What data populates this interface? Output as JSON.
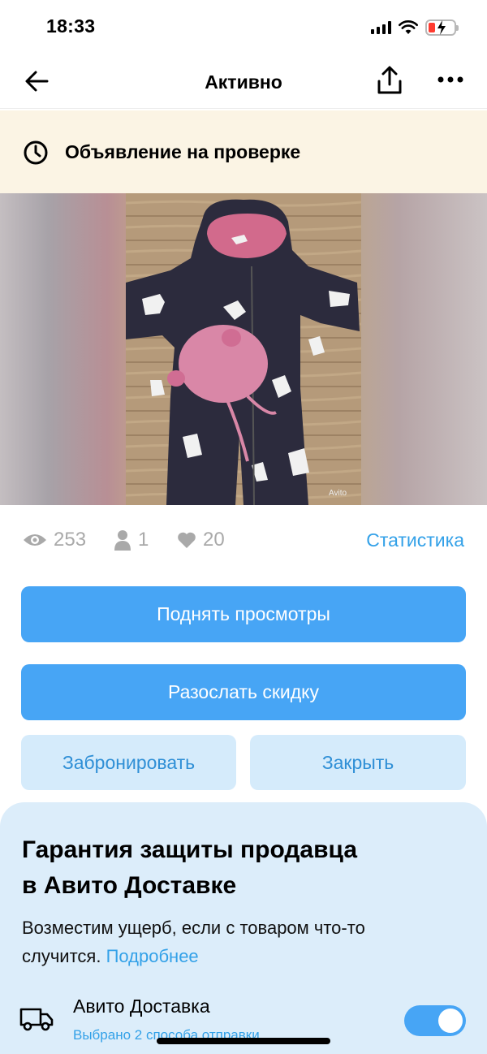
{
  "status_bar": {
    "time": "18:33",
    "icons": [
      "cellular-signal-icon",
      "wifi-icon",
      "battery-charging-icon"
    ],
    "battery_color": "#ff3b30"
  },
  "nav": {
    "title": "Активно",
    "back_icon": "arrow-left-icon",
    "share_icon": "share-icon",
    "more_icon": "more-horizontal-icon"
  },
  "review_banner": {
    "text": "Объявление на проверке",
    "icon": "clock-icon",
    "background": "#fbf4e4"
  },
  "listing_photo": {
    "description_icon": "photo-kids-winter-jumpsuit",
    "watermark": "Avito"
  },
  "stats": {
    "views": "253",
    "contacts": "1",
    "favorites": "20",
    "views_icon": "eye-icon",
    "contacts_icon": "person-icon",
    "favorites_icon": "heart-icon",
    "link": "Статистика"
  },
  "actions": {
    "raise_views": "Поднять просмотры",
    "send_discount": "Разослать скидку",
    "reserve": "Забронировать",
    "close": "Закрыть"
  },
  "guarantee": {
    "title_line1": "Гарантия защиты продавца",
    "title_line2": "в Авито Доставке",
    "text": "Возместим ущерб, если с товаром что-то случится.",
    "link": "Подробнее",
    "delivery_title": "Авито Доставка",
    "delivery_subtitle": "Выбрано 2 способа отправки",
    "delivery_icon": "truck-icon",
    "toggle_on": true
  },
  "colors": {
    "accent": "#47a5f5",
    "link": "#33a1e8",
    "secondary_button": "#d5ebfb",
    "guarantee_bg": "#dcedfa"
  }
}
